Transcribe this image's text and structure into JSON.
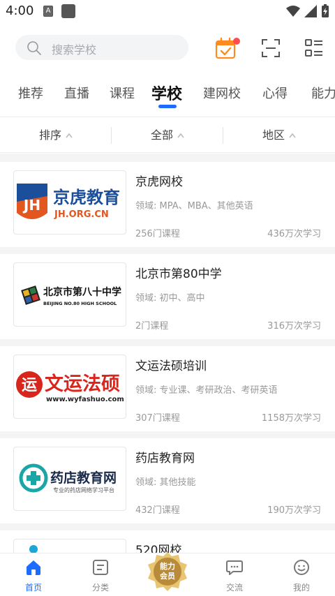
{
  "status": {
    "time": "4:00",
    "a_badge": "A"
  },
  "search": {
    "placeholder": "搜索学校"
  },
  "tabs": [
    "推荐",
    "直播",
    "课程",
    "学校",
    "建网校",
    "心得",
    "能力"
  ],
  "active_tab": "学校",
  "filters": [
    {
      "label": "排序"
    },
    {
      "label": "全部"
    },
    {
      "label": "地区"
    }
  ],
  "schools": [
    {
      "name": "京虎网校",
      "field": "领域: MPA、MBA、其他英语",
      "courses": "256门课程",
      "learners": "436万次学习",
      "logo": {
        "mark": "JH",
        "title": "京虎教育",
        "sub": "JH.ORG.CN"
      }
    },
    {
      "name": "北京市第80中学",
      "field": "领域: 初中、高中",
      "courses": "2门课程",
      "learners": "316万次学习",
      "logo": {
        "title": "北京市第八十中学",
        "sub": "BEIJING NO.80 HIGH SCHOOL"
      }
    },
    {
      "name": "文运法硕培训",
      "field": "领域: 专业课、考研政治、考研英语",
      "courses": "307门课程",
      "learners": "1158万次学习",
      "logo": {
        "mark": "运",
        "title": "文运法硕",
        "sub": "www.wyfashuo.com"
      }
    },
    {
      "name": "药店教育网",
      "field": "领域: 其他技能",
      "courses": "432门课程",
      "learners": "190万次学习",
      "logo": {
        "title": "药店教育网",
        "sub": "专业的药店网络学习平台"
      }
    },
    {
      "name": "520网校",
      "field": "",
      "courses": "",
      "learners": "",
      "logo": {}
    }
  ],
  "bottom_nav": [
    {
      "label": "首页",
      "icon": "home-icon",
      "active": true
    },
    {
      "label": "分类",
      "icon": "category-icon",
      "active": false
    },
    {
      "label": "",
      "icon": "vip-badge-icon",
      "badge_top": "能力",
      "badge_bottom": "会员"
    },
    {
      "label": "交流",
      "icon": "chat-icon",
      "active": false
    },
    {
      "label": "我的",
      "icon": "profile-icon",
      "active": false
    }
  ],
  "colors": {
    "accent": "#1e6cff",
    "calendar": "#ff8a1f",
    "notify_dot": "#ff4d4f"
  }
}
